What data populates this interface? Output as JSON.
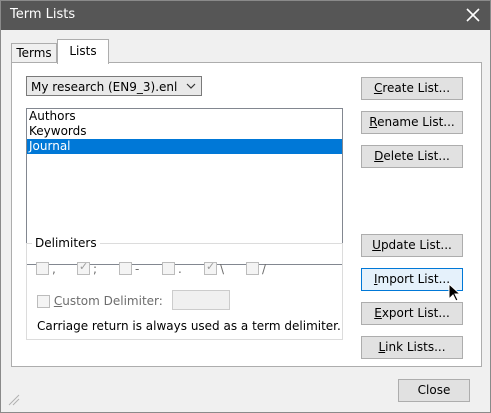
{
  "window": {
    "title": "Term Lists"
  },
  "tabs": [
    {
      "label": "Terms"
    },
    {
      "label": "Lists"
    }
  ],
  "library_select": {
    "value": "My research (EN9_3).enl"
  },
  "lists": [
    {
      "label": "Authors"
    },
    {
      "label": "Keywords"
    },
    {
      "label": "Journal",
      "selected": true
    }
  ],
  "buttons": {
    "create": {
      "prefix": "",
      "accel": "C",
      "rest": "reate List..."
    },
    "rename": {
      "prefix": "",
      "accel": "R",
      "rest": "ename List..."
    },
    "delete": {
      "prefix": "",
      "accel": "D",
      "rest": "elete List..."
    },
    "update": {
      "prefix": "",
      "accel": "U",
      "rest": "pdate List..."
    },
    "import": {
      "prefix": "",
      "accel": "I",
      "rest": "mport List..."
    },
    "export": {
      "prefix": "",
      "accel": "E",
      "rest": "xport List..."
    },
    "link": {
      "prefix": "",
      "accel": "L",
      "rest": "ink Lists..."
    }
  },
  "delimiters": {
    "legend": "Delimiters",
    "options": [
      {
        "symbol": ",",
        "checked": false
      },
      {
        "symbol": ";",
        "checked": true
      },
      {
        "symbol": "-",
        "checked": false
      },
      {
        "symbol": ".",
        "checked": false
      },
      {
        "symbol": "\\",
        "checked": true
      },
      {
        "symbol": "/",
        "checked": false
      }
    ],
    "custom_accel": "C",
    "custom_rest": "ustom Delimiter:",
    "note": "Carriage return is always used as a term delimiter."
  },
  "close_label": "Close"
}
